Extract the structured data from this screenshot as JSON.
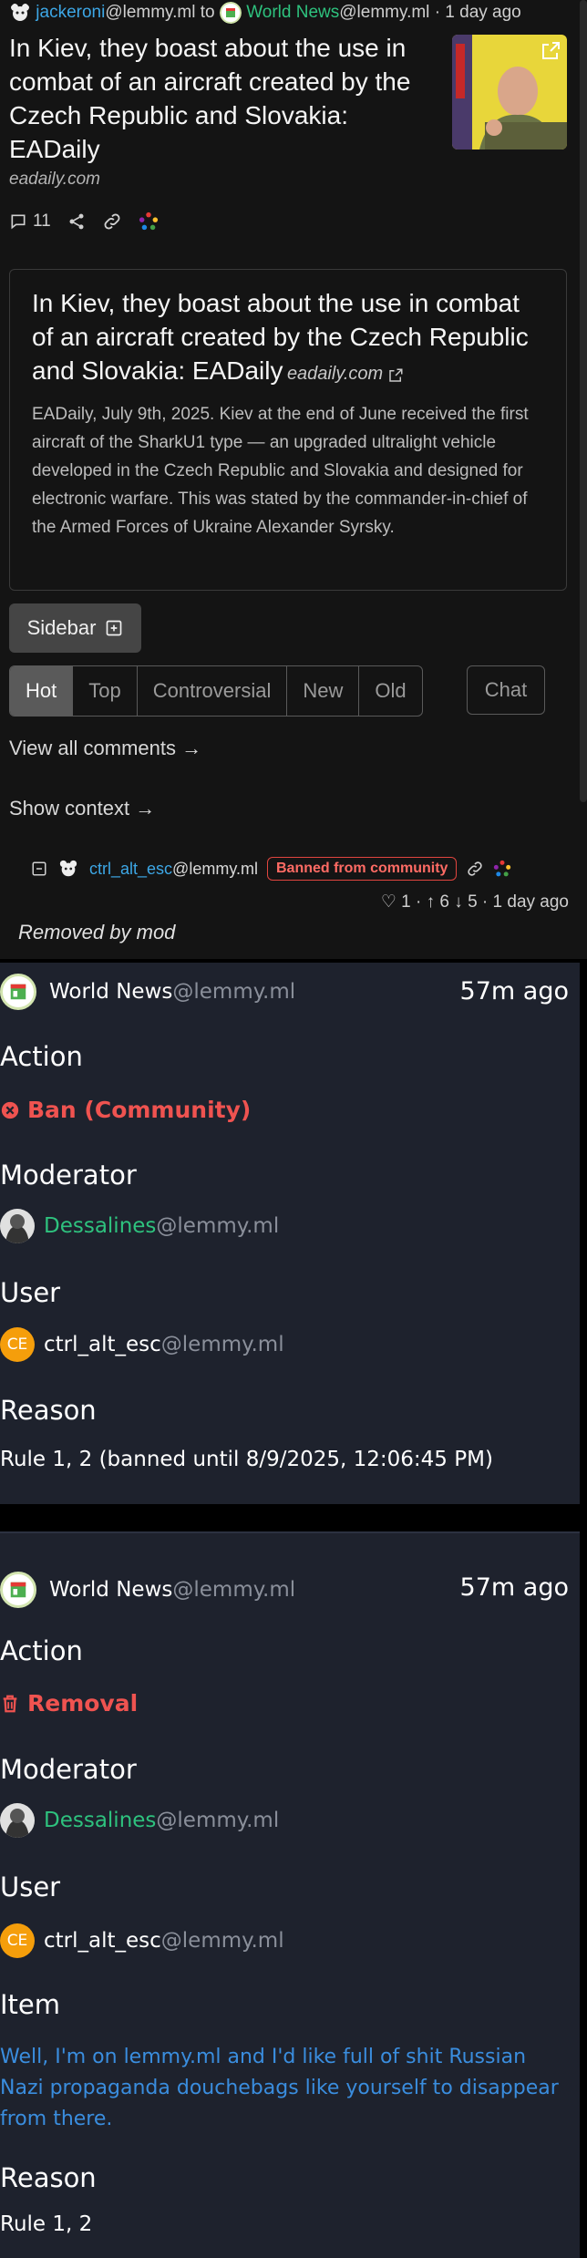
{
  "post": {
    "author": "jackeroni",
    "author_instance": "@lemmy.ml",
    "to_word": "to",
    "community": "World News",
    "community_instance": "@lemmy.ml",
    "age": "· 1 day ago",
    "title": "In Kiev, they boast about the use in combat of an aircraft created by the Czech Republic and Slovakia: EADaily",
    "domain": "eadaily.com",
    "comment_count": "11",
    "thumbnail_icon": "external-link-icon"
  },
  "card": {
    "title": "In Kiev, they boast about the use in combat of an aircraft created by the Czech Republic and Slovakia: EADaily",
    "domain": "eadaily.com",
    "body": "EADaily, July 9th, 2025. Kiev at the end of June received the first aircraft of the SharkU1 type — an upgraded ultralight vehicle developed in the Czech Republic and Slovakia and designed for electronic warfare. This was stated by the commander-in-chief of the Armed Forces of Ukraine Alexander Syrsky."
  },
  "sidebar_label": "Sidebar",
  "sort_options": [
    "Hot",
    "Top",
    "Controversial",
    "New",
    "Old"
  ],
  "chat_label": "Chat",
  "view_all_comments": "View all comments →",
  "show_context": "Show context →",
  "comment": {
    "author": "ctrl_alt_esc",
    "instance": "@lemmy.ml",
    "badge": "Banned from community",
    "score": "1",
    "upvotes": "6",
    "downvotes": "5",
    "age": "1 day ago",
    "content": "Removed by mod"
  },
  "modlog": [
    {
      "community": "World News",
      "community_instance": "@lemmy.ml",
      "time": "57m ago",
      "action_label": "Action",
      "action": "Ban (Community)",
      "action_icon": "x-circle-icon",
      "moderator_label": "Moderator",
      "moderator": "Dessalines",
      "moderator_instance": "@lemmy.ml",
      "user_label": "User",
      "user_initials": "CE",
      "user": "ctrl_alt_esc",
      "user_instance": "@lemmy.ml",
      "reason_label": "Reason",
      "reason": "Rule 1, 2 (banned until 8/9/2025, 12:06:45 PM)"
    },
    {
      "community": "World News",
      "community_instance": "@lemmy.ml",
      "time": "57m ago",
      "action_label": "Action",
      "action": "Removal",
      "action_icon": "trash-icon",
      "moderator_label": "Moderator",
      "moderator": "Dessalines",
      "moderator_instance": "@lemmy.ml",
      "user_label": "User",
      "user_initials": "CE",
      "user": "ctrl_alt_esc",
      "user_instance": "@lemmy.ml",
      "item_label": "Item",
      "item": "Well, I'm on lemmy.ml and I'd like full of shit Russian Nazi propaganda douchebags like yourself to disappear from there.",
      "reason_label": "Reason",
      "reason": "Rule 1, 2"
    }
  ],
  "colors": {
    "accent_blue": "#3da7e6",
    "accent_green": "#2ec27e",
    "danger": "#ef5350",
    "modlog_bg": "#1e222d"
  }
}
